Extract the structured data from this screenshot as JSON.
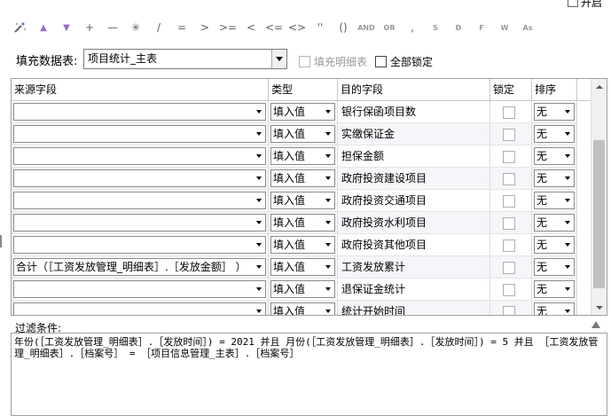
{
  "top_option": {
    "label": "开启"
  },
  "toolbar": {
    "buttons": [
      {
        "name": "auto-fill-icon",
        "glyph": ""
      },
      {
        "name": "move-up-icon",
        "glyph": "▲"
      },
      {
        "name": "move-down-icon",
        "glyph": "▼"
      },
      {
        "name": "plus-operator-icon",
        "glyph": "+"
      },
      {
        "name": "minus-operator-icon",
        "glyph": "—"
      },
      {
        "name": "multiply-operator-icon",
        "glyph": "✳"
      },
      {
        "name": "divide-operator-icon",
        "glyph": "/"
      },
      {
        "name": "equals-operator-icon",
        "glyph": "="
      },
      {
        "name": "greater-than-icon",
        "glyph": ">"
      },
      {
        "name": "greater-equal-icon",
        "glyph": ">="
      },
      {
        "name": "less-than-icon",
        "glyph": "<"
      },
      {
        "name": "less-equal-icon",
        "glyph": "<="
      },
      {
        "name": "not-equal-icon",
        "glyph": "<>"
      },
      {
        "name": "quotes-icon",
        "glyph": "''"
      },
      {
        "name": "parentheses-icon",
        "glyph": "()"
      },
      {
        "name": "and-operator-icon",
        "glyph": "AND"
      },
      {
        "name": "or-operator-icon",
        "glyph": "OR"
      },
      {
        "name": "comma-icon",
        "glyph": ","
      },
      {
        "name": "s-function-icon",
        "glyph": "S"
      },
      {
        "name": "d-function-icon",
        "glyph": "D"
      },
      {
        "name": "f-function-icon",
        "glyph": "F"
      },
      {
        "name": "w-function-icon",
        "glyph": "W"
      },
      {
        "name": "as-function-icon",
        "glyph": "As"
      }
    ]
  },
  "fill_table": {
    "label": "填充数据表:",
    "value": "项目统计_主表",
    "fill_detail_label": "填充明细表",
    "lock_all_label": "全部锁定"
  },
  "grid": {
    "headers": {
      "source": "来源字段",
      "type": "类型",
      "target": "目的字段",
      "lock": "锁定",
      "sort": "排序"
    },
    "rows": [
      {
        "source": "",
        "type": "填入值",
        "target": "银行保函项目数",
        "sort": "无"
      },
      {
        "source": "",
        "type": "填入值",
        "target": "实缴保证金",
        "sort": "无"
      },
      {
        "source": "",
        "type": "填入值",
        "target": "担保金额",
        "sort": "无"
      },
      {
        "source": "",
        "type": "填入值",
        "target": "政府投资建设项目",
        "sort": "无"
      },
      {
        "source": "",
        "type": "填入值",
        "target": "政府投资交通项目",
        "sort": "无"
      },
      {
        "source": "",
        "type": "填入值",
        "target": "政府投资水利项目",
        "sort": "无"
      },
      {
        "source": "",
        "type": "填入值",
        "target": "政府投资其他项目",
        "sort": "无"
      },
      {
        "source": "合计（［工资发放管理_明细表］.［发放金额］ ）",
        "type": "填入值",
        "target": "工资发放累计",
        "sort": "无"
      },
      {
        "source": "",
        "type": "填入值",
        "target": "退保证金统计",
        "sort": "无"
      },
      {
        "source": "",
        "type": "填入值",
        "target": "统计开始时间",
        "sort": "无"
      }
    ]
  },
  "filter": {
    "label": "过滤条件:",
    "text": "年份(［工资发放管理_明细表］.［发放时间］)  = 2021 并且 月份(［工资发放管理_明细表］.［发放时间］)  = 5  并且  ［工资发放管理_明细表］.［档案号］  =  ［项目信息管理_主表］.［档案号］"
  }
}
